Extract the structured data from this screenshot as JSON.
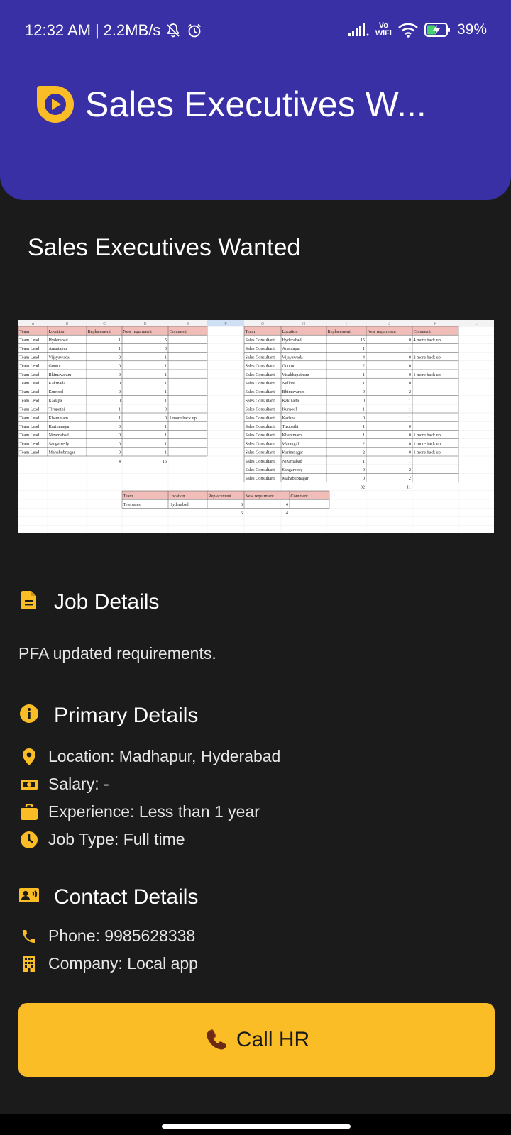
{
  "status_bar": {
    "time": "12:32 AM",
    "separator": "|",
    "speed": "2.2MB/s",
    "vo": "Vo",
    "wifi_label": "WiFi",
    "battery": "39%"
  },
  "header": {
    "title": "Sales Executives W...",
    "logo_icon": "play-circle-icon",
    "bg_color": "#3a30a6"
  },
  "job_title": "Sales Executives Wanted",
  "spreadsheet": {
    "col_letters": [
      "A",
      "B",
      "C",
      "D",
      "E",
      "F",
      "G",
      "H",
      "I",
      "J",
      "K",
      "L"
    ],
    "left_table": {
      "headers": [
        "Team",
        "Location",
        "Replacement",
        "New requirment",
        "Comment"
      ],
      "rows": [
        [
          "Team Lead",
          "Hyderabad",
          "1",
          "5",
          ""
        ],
        [
          "Team Lead",
          "Anantapur",
          "1",
          "0",
          ""
        ],
        [
          "Team Lead",
          "Vijayawada",
          "0",
          "1",
          ""
        ],
        [
          "Team Lead",
          "Guntur",
          "0",
          "1",
          ""
        ],
        [
          "Team Lead",
          "Bhimavaram",
          "0",
          "1",
          ""
        ],
        [
          "Team Lead",
          "Kakinada",
          "0",
          "1",
          ""
        ],
        [
          "Team Lead",
          "Kurnool",
          "0",
          "1",
          ""
        ],
        [
          "Team Lead",
          "Kadapa",
          "0",
          "1",
          ""
        ],
        [
          "Team Lead",
          "Tirupathi",
          "1",
          "0",
          ""
        ],
        [
          "Team Lead",
          "Khammam",
          "1",
          "0",
          "1 more back up"
        ],
        [
          "Team Lead",
          "Karimnagar",
          "0",
          "1",
          ""
        ],
        [
          "Team Lead",
          "Nizamabad",
          "0",
          "1",
          ""
        ],
        [
          "Team Lead",
          "Sangareedy",
          "0",
          "1",
          ""
        ],
        [
          "Team Lead",
          "Mahabubnagar",
          "0",
          "1",
          ""
        ]
      ],
      "totals": [
        "4",
        "15"
      ]
    },
    "right_table": {
      "headers": [
        "Team",
        "Location",
        "Replacement",
        "New requirment",
        "Comment"
      ],
      "rows": [
        [
          "Sales Consultant",
          "Hyderabad",
          "15",
          "0",
          "4  more back up"
        ],
        [
          "Sales Consultant",
          "Anantapur",
          "1",
          "1",
          ""
        ],
        [
          "Sales Consultant",
          "Vijayawada",
          "4",
          "0",
          "2 more back up"
        ],
        [
          "Sales Consultant",
          "Guntur",
          "2",
          "0",
          ""
        ],
        [
          "Sales Consultant",
          "Visakhapatnam",
          "1",
          "0",
          "1 more back up"
        ],
        [
          "Sales Consultant",
          "Nellore",
          "1",
          "0",
          ""
        ],
        [
          "Sales Consultant",
          "Bhimavaram",
          "0",
          "2",
          ""
        ],
        [
          "Sales Consultant",
          "Kakinada",
          "0",
          "1",
          ""
        ],
        [
          "Sales Consultant",
          "Kurnool",
          "1",
          "1",
          ""
        ],
        [
          "Sales Consultant",
          "Kadapa",
          "0",
          "1",
          ""
        ],
        [
          "Sales Consultant",
          "Tirupathi",
          "1",
          "0",
          ""
        ],
        [
          "Sales Consultant",
          "Khammam",
          "1",
          "0",
          "1 more back up"
        ],
        [
          "Sales Consultant",
          "Warangal",
          "2",
          "0",
          "1 more back up"
        ],
        [
          "Sales Consultant",
          "Karimnagar",
          "2",
          "0",
          "1 more back up"
        ],
        [
          "Sales Consultant",
          "Nizamabad",
          "1",
          "1",
          ""
        ],
        [
          "Sales Consultant",
          "Sangareedy",
          "0",
          "2",
          ""
        ],
        [
          "Sales Consultant",
          "Mahabubnagar",
          "0",
          "2",
          ""
        ]
      ],
      "totals": [
        "32",
        "11"
      ]
    },
    "tele_table": {
      "headers": [
        "Team",
        "Location",
        "Replacement",
        "New requirment",
        "Comment"
      ],
      "rows": [
        [
          "Tele sales",
          "Hyderabad",
          "6",
          "4",
          ""
        ]
      ],
      "totals": [
        "6",
        "4"
      ]
    }
  },
  "job_details": {
    "title": "Job Details",
    "icon": "document-icon",
    "description": "PFA updated requirements."
  },
  "primary_details": {
    "title": "Primary Details",
    "icon": "info-icon",
    "items": [
      {
        "icon": "location-pin-icon",
        "text": "Location: Madhapur, Hyderabad"
      },
      {
        "icon": "money-icon",
        "text": "Salary: -"
      },
      {
        "icon": "briefcase-icon",
        "text": "Experience: Less than 1 year"
      },
      {
        "icon": "clock-icon",
        "text": "Job Type: Full time"
      }
    ]
  },
  "contact_details": {
    "title": "Contact Details",
    "icon": "contact-card-icon",
    "items": [
      {
        "icon": "phone-icon",
        "text": "Phone: 9985628338"
      },
      {
        "icon": "building-icon",
        "text": "Company: Local app"
      }
    ]
  },
  "call_button": {
    "label": "Call HR",
    "icon": "telephone-receiver-icon"
  },
  "colors": {
    "accent": "#fbbd25",
    "header": "#3a30a6",
    "background": "#1b1b1b",
    "sheet_header": "#f0bdb9"
  }
}
